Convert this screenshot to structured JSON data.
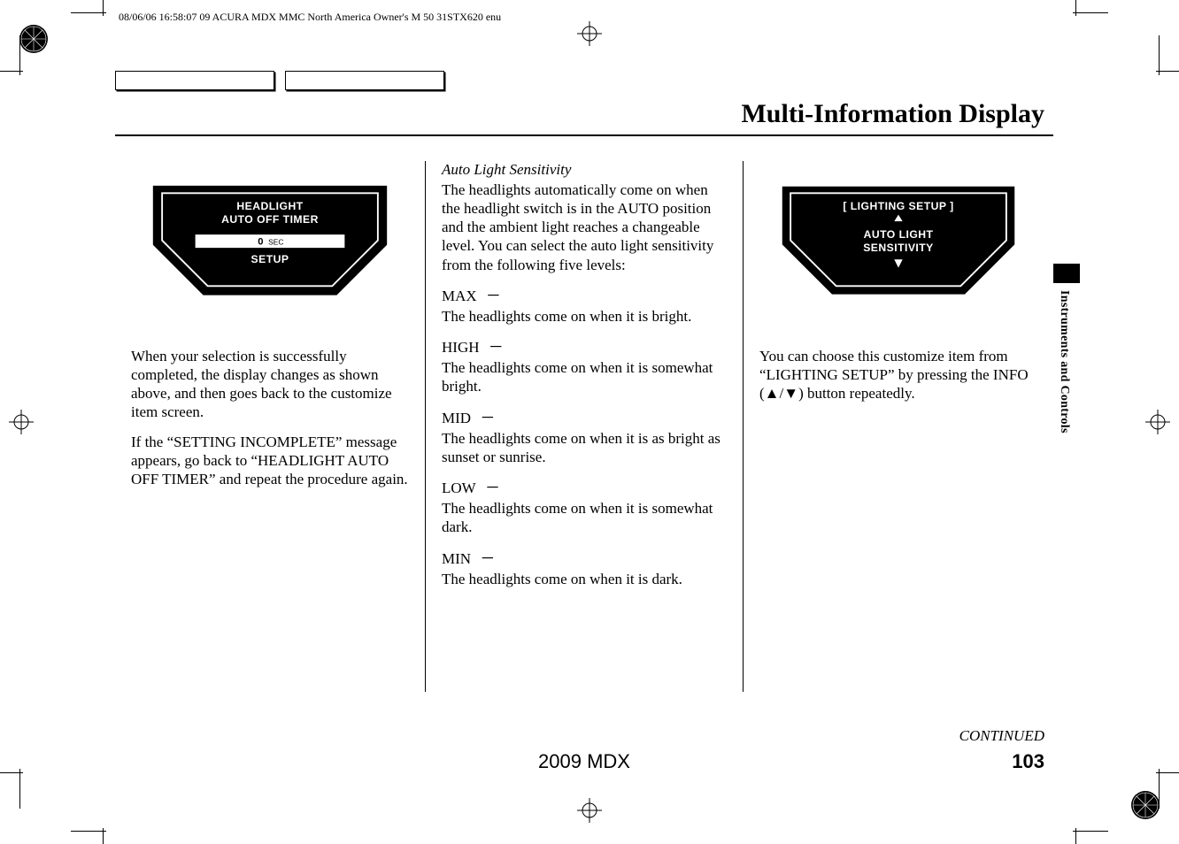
{
  "slug": "08/06/06 16:58:07   09 ACURA MDX MMC North America Owner's M 50 31STX620 enu",
  "section_title": "Multi-Information Display",
  "col1": {
    "display": {
      "line1": "HEADLIGHT",
      "line2": "AUTO OFF TIMER",
      "bar_value": "0",
      "bar_unit": "SEC",
      "setup": "SETUP"
    },
    "p1": "When your selection is successfully completed, the display changes as shown above, and then goes back to the customize item screen.",
    "p2": "If the “SETTING INCOMPLETE” message appears, go back to “HEADLIGHT AUTO OFF TIMER” and repeat the procedure again."
  },
  "col2": {
    "subhead": "Auto Light Sensitivity",
    "intro": "The headlights automatically come on when the headlight switch is in the AUTO position and the ambient light reaches a changeable level. You can select the auto light sensitivity from the following five levels:",
    "levels": [
      {
        "name": "MAX",
        "desc": "The headlights come on when it is bright."
      },
      {
        "name": "HIGH",
        "desc": "The headlights come on when it is somewhat bright."
      },
      {
        "name": "MID",
        "desc": "The headlights come on when it is as bright as sunset or sunrise."
      },
      {
        "name": "LOW",
        "desc": "The headlights come on when it is somewhat dark."
      },
      {
        "name": "MIN",
        "desc": "The headlights come on when it is dark."
      }
    ]
  },
  "col3": {
    "display": {
      "bracket": "[ LIGHTING SETUP ]",
      "line1": "AUTO LIGHT",
      "line2": "SENSITIVITY"
    },
    "p1_a": "You can choose this customize item from “LIGHTING SETUP” by pressing the INFO (",
    "p1_b": ") button repeatedly."
  },
  "continued": "CONTINUED",
  "model": "2009  MDX",
  "page": "103",
  "tab_label": "Instruments and Controls"
}
